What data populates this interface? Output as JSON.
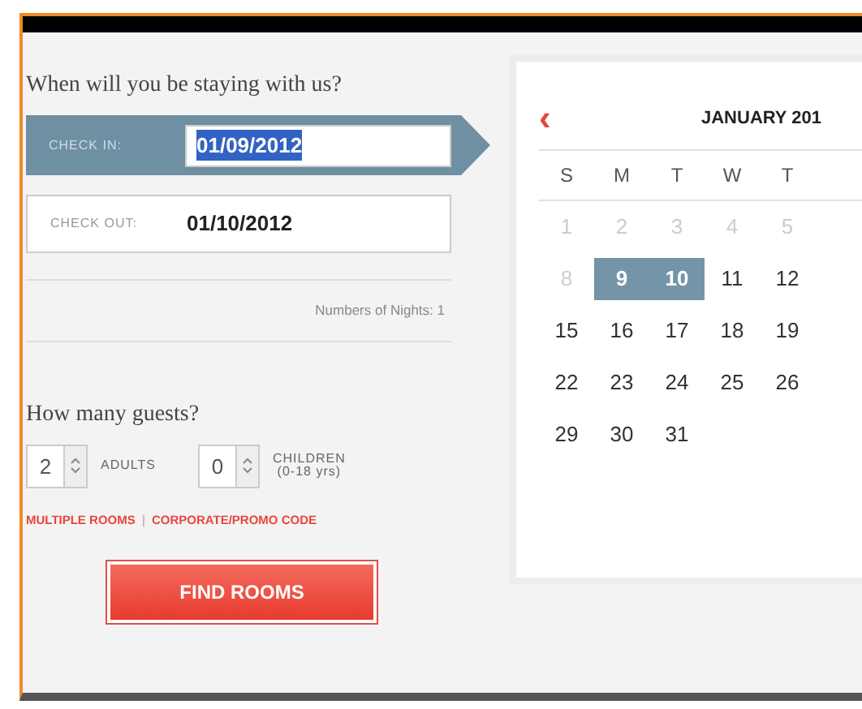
{
  "stay": {
    "heading": "When will you be staying with us?",
    "check_in": {
      "label": "CHECK IN:",
      "value": "01/09/2012",
      "selected": true
    },
    "check_out": {
      "label": "CHECK OUT:",
      "value": "01/10/2012",
      "selected": false
    },
    "nights": "Numbers of Nights: 1"
  },
  "guests": {
    "heading": "How many guests?",
    "adults": {
      "count": "2",
      "caption": "ADULTS"
    },
    "children": {
      "count": "0",
      "caption": "CHILDREN",
      "age_range": "(0-18 yrs)"
    },
    "links": [
      "MULTIPLE ROOMS",
      "CORPORATE/PROMO CODE"
    ],
    "separator": "|",
    "button": "FIND ROOMS"
  },
  "calendar": {
    "prev": "‹",
    "title": "JANUARY 201",
    "weekdays": [
      "S",
      "M",
      "T",
      "W",
      "T"
    ],
    "weeks": [
      [
        {
          "label": "1",
          "past": true,
          "selected": false
        },
        {
          "label": "2",
          "past": true,
          "selected": false
        },
        {
          "label": "3",
          "past": true,
          "selected": false
        },
        {
          "label": "4",
          "past": true,
          "selected": false
        },
        {
          "label": "5",
          "past": true,
          "selected": false
        }
      ],
      [
        {
          "label": "8",
          "past": true,
          "selected": false
        },
        {
          "label": "9",
          "past": false,
          "selected": true
        },
        {
          "label": "10",
          "past": false,
          "selected": true
        },
        {
          "label": "11",
          "past": false,
          "selected": false
        },
        {
          "label": "12",
          "past": false,
          "selected": false
        }
      ],
      [
        {
          "label": "15",
          "past": false,
          "selected": false
        },
        {
          "label": "16",
          "past": false,
          "selected": false
        },
        {
          "label": "17",
          "past": false,
          "selected": false
        },
        {
          "label": "18",
          "past": false,
          "selected": false
        },
        {
          "label": "19",
          "past": false,
          "selected": false
        }
      ],
      [
        {
          "label": "22",
          "past": false,
          "selected": false
        },
        {
          "label": "23",
          "past": false,
          "selected": false
        },
        {
          "label": "24",
          "past": false,
          "selected": false
        },
        {
          "label": "25",
          "past": false,
          "selected": false
        },
        {
          "label": "26",
          "past": false,
          "selected": false
        }
      ],
      [
        {
          "label": "29",
          "past": false,
          "selected": false
        },
        {
          "label": "30",
          "past": false,
          "selected": false
        },
        {
          "label": "31",
          "past": false,
          "selected": false
        }
      ]
    ]
  }
}
